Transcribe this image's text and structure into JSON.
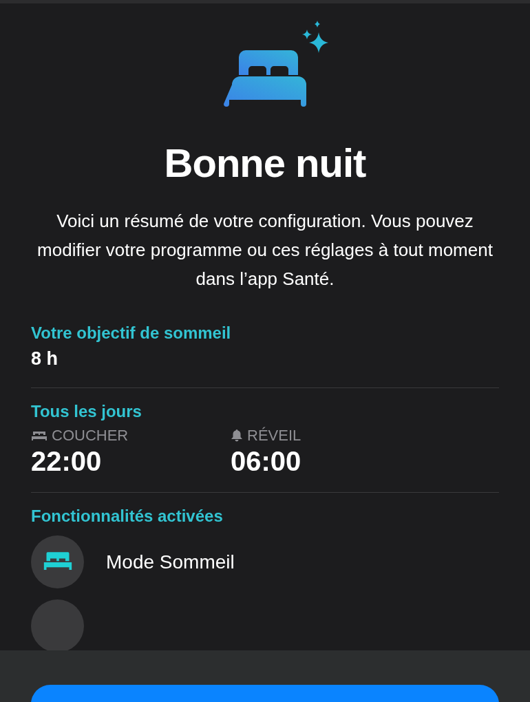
{
  "title": "Bonne nuit",
  "description": "Voici un résumé de votre configuration. Vous pouvez modifier votre programme ou ces réglages à tout moment dans l’app Santé.",
  "goal": {
    "label": "Votre objectif de sommeil",
    "value": "8 h"
  },
  "schedule": {
    "label": "Tous les jours",
    "times": [
      {
        "kind": "bedtime",
        "label": "COUCHER",
        "value": "22:00"
      },
      {
        "kind": "wake",
        "label": "RÉVEIL",
        "value": "06:00"
      }
    ]
  },
  "features": {
    "label": "Fonctionnalités activées",
    "items": [
      {
        "label": "Mode Sommeil"
      }
    ]
  }
}
